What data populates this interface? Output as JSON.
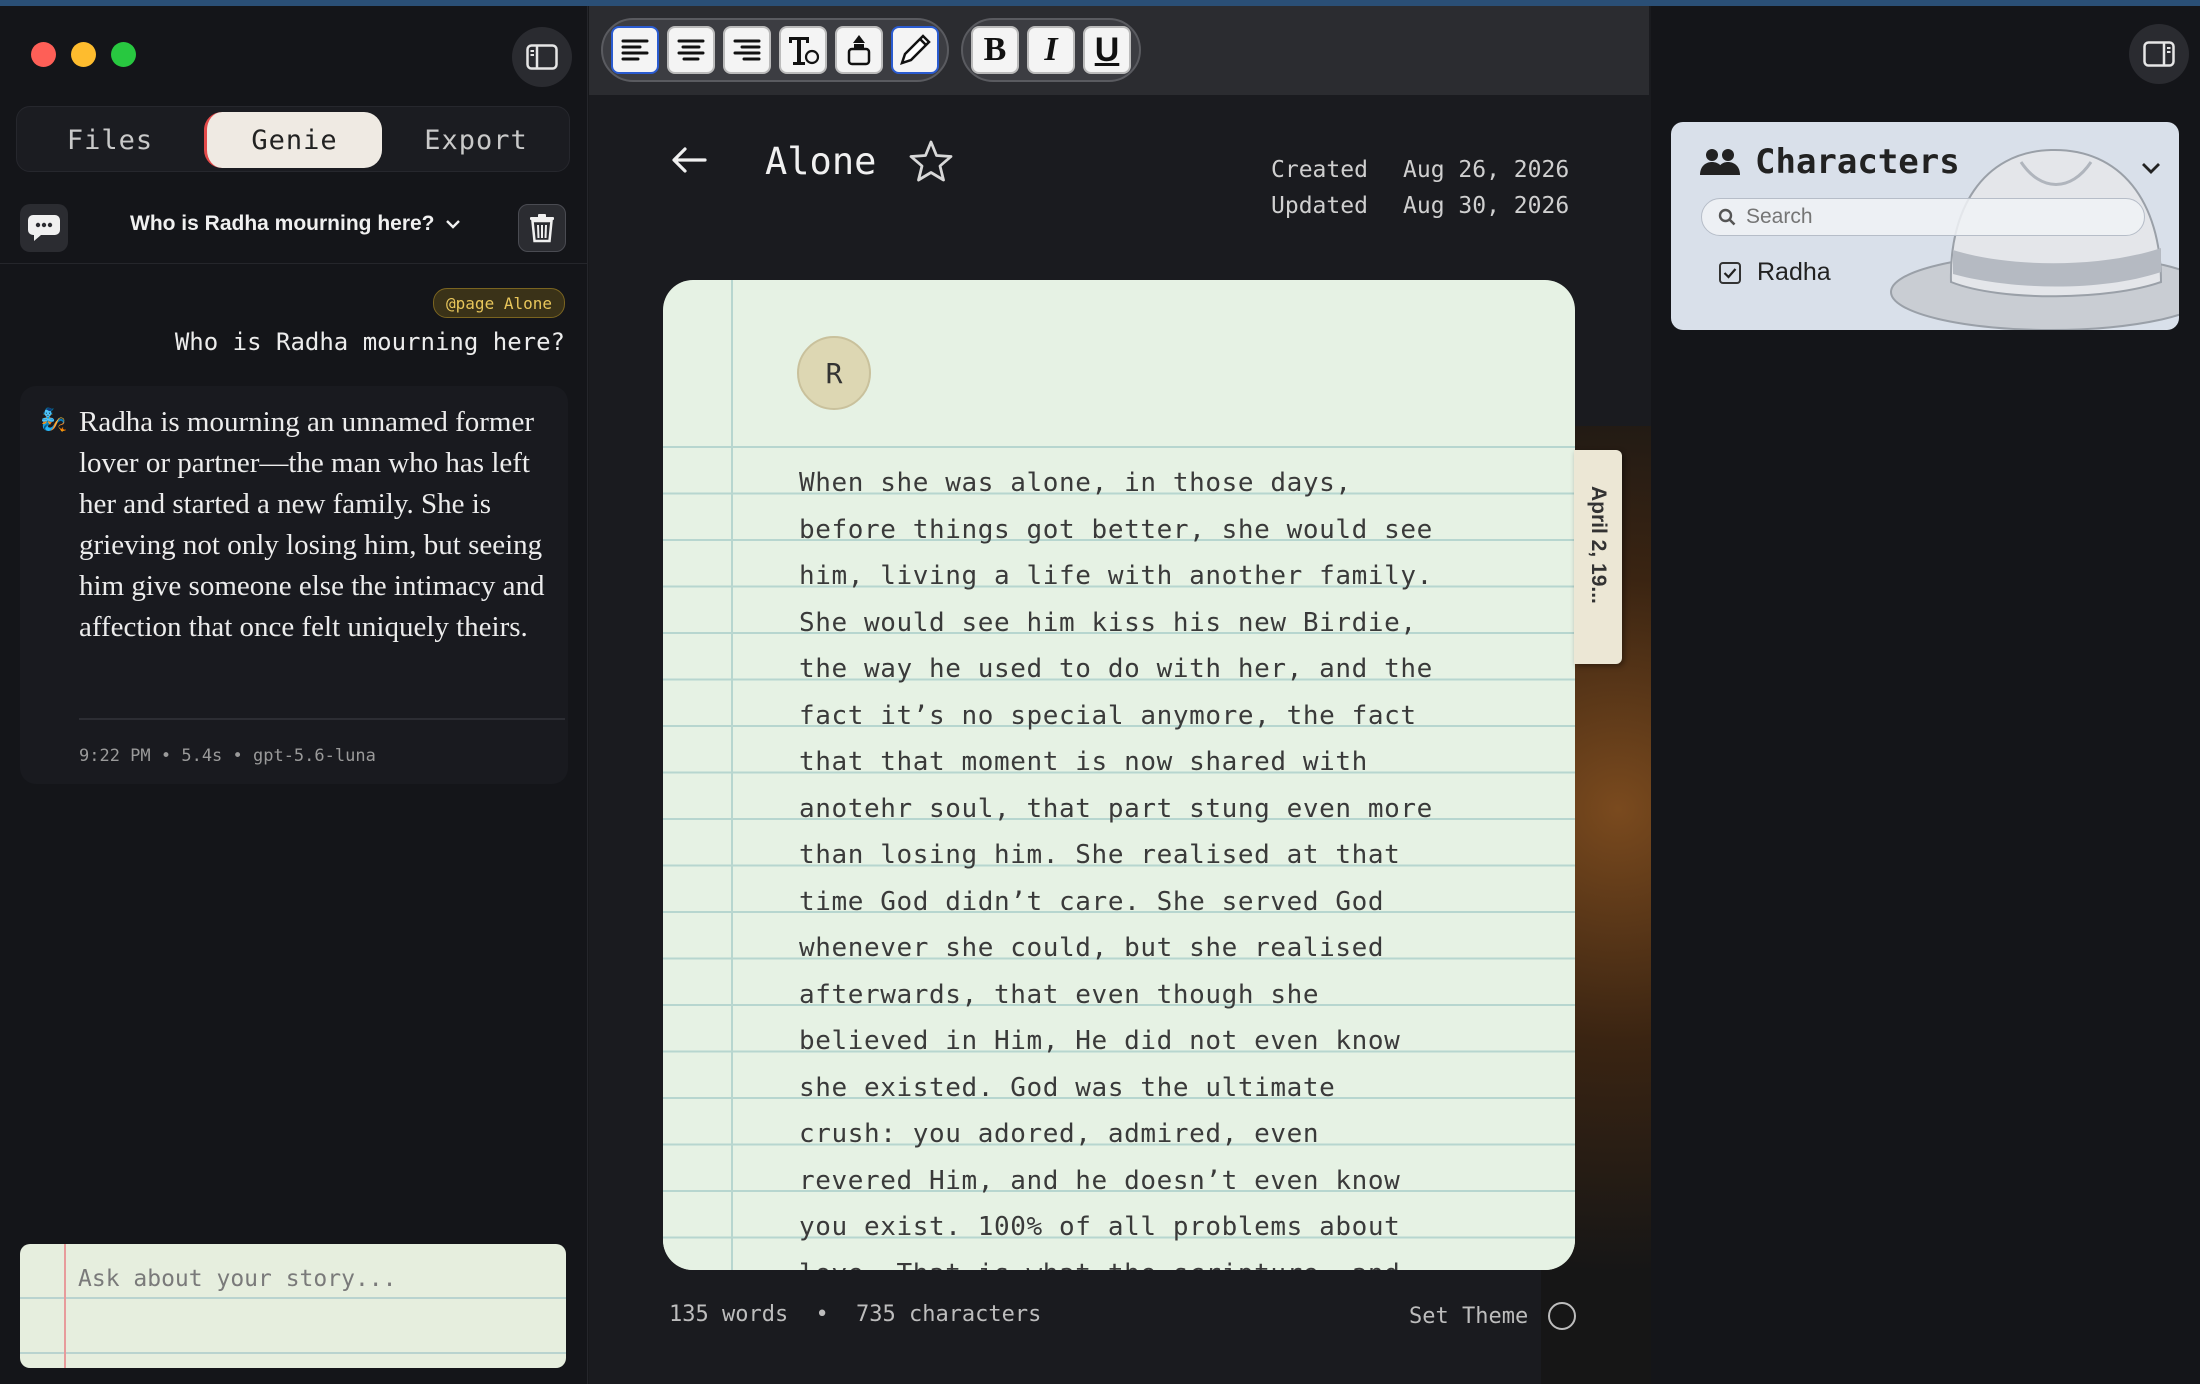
{
  "sidebar": {
    "tabs": [
      {
        "label": "Files"
      },
      {
        "label": "Genie"
      },
      {
        "label": "Export"
      }
    ],
    "active_tab": "Genie",
    "chat": {
      "title": "Who is Radha mourning here?",
      "user_tag": "@page Alone",
      "user_message": "Who is Radha mourning here?",
      "answer_avatar": "🧞",
      "answer": "Radha is mourning an unnamed former lover or partner—the man who has left her and started a new family. She is grieving not only losing him, but seeing him give someone else the intimacy and affection that once felt uniquely theirs.",
      "answer_meta": "9:22 PM • 5.4s • gpt-5.6-luna"
    },
    "ask_placeholder": "Ask about your story..."
  },
  "toolbar": {
    "buttons": [
      {
        "icon": "align-left-icon"
      },
      {
        "icon": "align-center-icon"
      },
      {
        "icon": "align-right-icon"
      },
      {
        "icon": "typewriter-font-icon"
      },
      {
        "icon": "ink-icon"
      },
      {
        "icon": "pen-icon"
      },
      {
        "label": "B",
        "icon": "bold-icon"
      },
      {
        "label": "I",
        "icon": "italic-icon"
      },
      {
        "label": "U",
        "icon": "underline-icon"
      }
    ]
  },
  "document": {
    "title": "Alone",
    "created_label": "Created",
    "created": "Aug 26, 2026",
    "updated_label": "Updated",
    "updated": "Aug 30, 2026",
    "author_initial": "R",
    "date_tab": "April 2, 19...",
    "body": "When she was alone, in those days,\nbefore things got better, she would see\nhim, living a life with another family.\nShe would see him kiss his new Birdie,\nthe way he used to do with her, and the\nfact it’s no special anymore, the fact\nthat that moment is now shared with\nanotehr soul, that part stung even more\nthan losing him. She realised at that\ntime God didn’t care. She served God\nwhenever she could, but she realised\nafterwards, that even though she\nbelieved in Him, He did not even know\nshe existed. God was the ultimate\ncrush: you adored, admired, even\nrevered Him, and he doesn’t even know\nyou exist. 100% of all problems about\nlove. That is what the scripture, and",
    "word_count": "135 words",
    "separator": "•",
    "char_count": "735 characters",
    "set_theme": "Set Theme"
  },
  "characters": {
    "title": "Characters",
    "search_placeholder": "Search",
    "items": [
      {
        "name": "Radha",
        "checked": true
      }
    ]
  },
  "colors": {
    "accent_red": "#e34a4a",
    "paper": "#e6f2e4",
    "tag_gold": "#e8c65b",
    "toolbar_border": "#2a5bd0"
  }
}
